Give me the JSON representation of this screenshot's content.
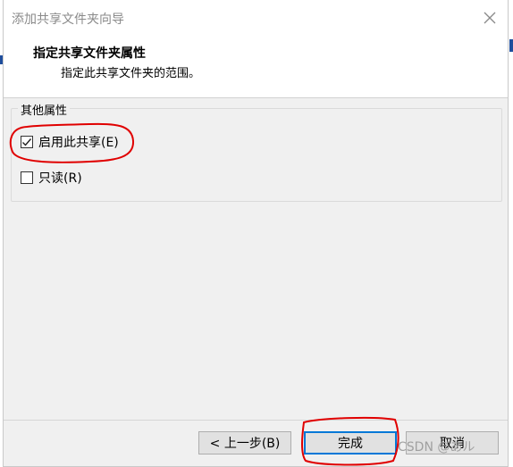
{
  "dialog": {
    "title": "添加共享文件夹向导",
    "header_title": "指定共享文件夹属性",
    "header_subtitle": "指定此共享文件夹的范围。"
  },
  "properties_group": {
    "legend": "其他属性",
    "enable_share": {
      "label": "启用此共享(E)",
      "checked": true
    },
    "read_only": {
      "label": "只读(R)",
      "checked": false
    }
  },
  "buttons": {
    "back": "< 上一步(B)",
    "finish": "完成",
    "cancel": "取消"
  },
  "watermark": "CSDN @あル",
  "background": {
    "peek_text": "· · · · ·  · · · · ·"
  },
  "colors": {
    "annotation": "#e00000",
    "focus_blue": "#0078d7"
  }
}
